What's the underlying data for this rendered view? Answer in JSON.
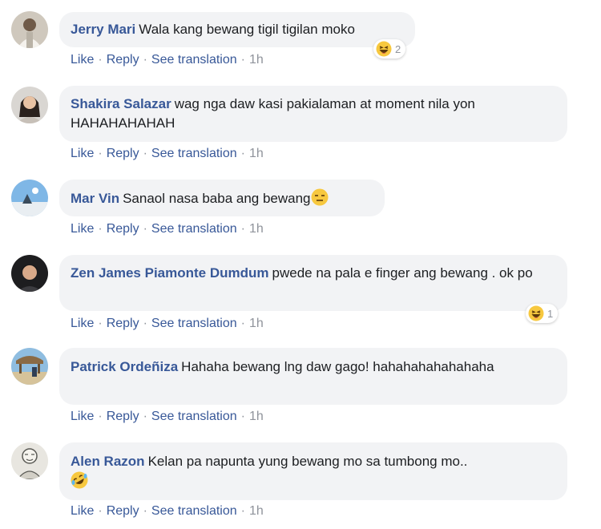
{
  "actions": {
    "like": "Like",
    "reply": "Reply",
    "translate": "See translation",
    "separator": "·"
  },
  "comments": [
    {
      "name": "Jerry Mari",
      "text": "Wala kang bewang tigil tigilan moko",
      "time": "1h",
      "reaction": {
        "icon": "haha-reaction-icon",
        "count": "2"
      }
    },
    {
      "name": "Shakira Salazar",
      "text": "wag nga daw kasi pakialaman at moment nila yon HAHAHAHAHAH",
      "time": "1h"
    },
    {
      "name": "Mar Vin",
      "text": "Sanaol nasa baba ang bewang",
      "emoji": "expressionless-face-emoji",
      "time": "1h"
    },
    {
      "name": "Zen James Piamonte Dumdum",
      "text": "pwede na pala e finger ang bewang . ok po",
      "time": "1h",
      "reaction": {
        "icon": "haha-reaction-icon",
        "count": "1"
      }
    },
    {
      "name": "Patrick Ordeñiza",
      "text": "Hahaha bewang lng daw gago! hahahahahahahaha",
      "time": "1h"
    },
    {
      "name": "Alen Razon",
      "text": "Kelan pa napunta yung bewang mo sa tumbong mo..",
      "emoji": "rolling-laughing-emoji",
      "time": "1h"
    }
  ],
  "colors": {
    "name": "#385898",
    "bubble": "#f2f3f5",
    "meta": "#90949c",
    "text": "#1c1e21"
  }
}
